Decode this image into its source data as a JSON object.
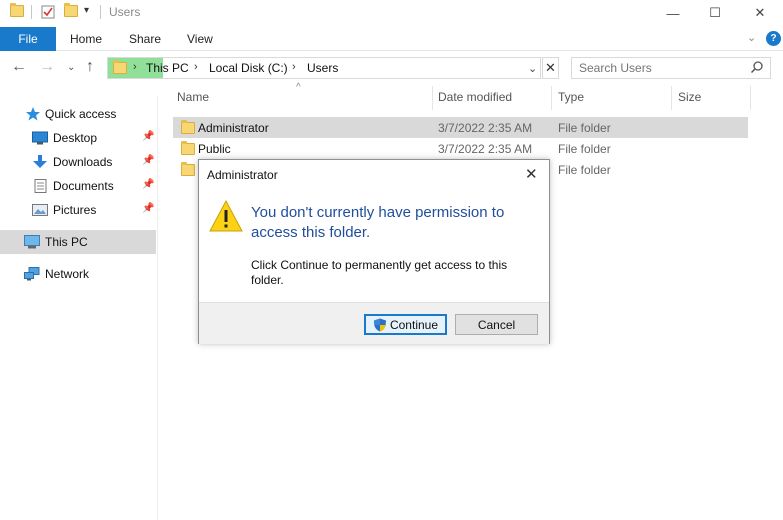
{
  "window": {
    "title": "Users",
    "minimize": "—",
    "maximize": "☐",
    "close": "✕"
  },
  "ribbon": {
    "tabs": [
      "File",
      "Home",
      "Share",
      "View"
    ],
    "expand": "⌄",
    "help": "?"
  },
  "address": {
    "crumbs": [
      "This PC",
      "Local Disk (C:)",
      "Users"
    ],
    "separator": "›",
    "dropdown": "⌄",
    "clear": "✕"
  },
  "search": {
    "placeholder": "Search Users"
  },
  "sidebar": {
    "items": [
      {
        "label": "Quick access",
        "icon": "star-icon"
      },
      {
        "label": "Desktop",
        "icon": "desktop-icon",
        "pinned": true
      },
      {
        "label": "Downloads",
        "icon": "download-icon",
        "pinned": true
      },
      {
        "label": "Documents",
        "icon": "document-icon",
        "pinned": true
      },
      {
        "label": "Pictures",
        "icon": "pictures-icon",
        "pinned": true
      },
      {
        "label": "This PC",
        "icon": "computer-icon",
        "selected": true
      },
      {
        "label": "Network",
        "icon": "network-icon"
      }
    ]
  },
  "columns": [
    "Name",
    "Date modified",
    "Type",
    "Size"
  ],
  "files": [
    {
      "name": "Administrator",
      "date": "3/7/2022 2:35 AM",
      "type": "File folder"
    },
    {
      "name": "Public",
      "date": "3/7/2022 2:35 AM",
      "type": "File folder"
    },
    {
      "name": "",
      "date": "",
      "type": "File folder"
    }
  ],
  "dialog": {
    "title": "Administrator",
    "main_text": "You don't currently have permission to access this folder.",
    "sub_text": "Click Continue to permanently get access to this folder.",
    "continue_label": "Continue",
    "cancel_label": "Cancel"
  },
  "colors": {
    "accent": "#1979ca",
    "selection": "#d9d9d9",
    "dialog_text": "#1f4e9c",
    "addr_highlight": "#90e09a"
  }
}
